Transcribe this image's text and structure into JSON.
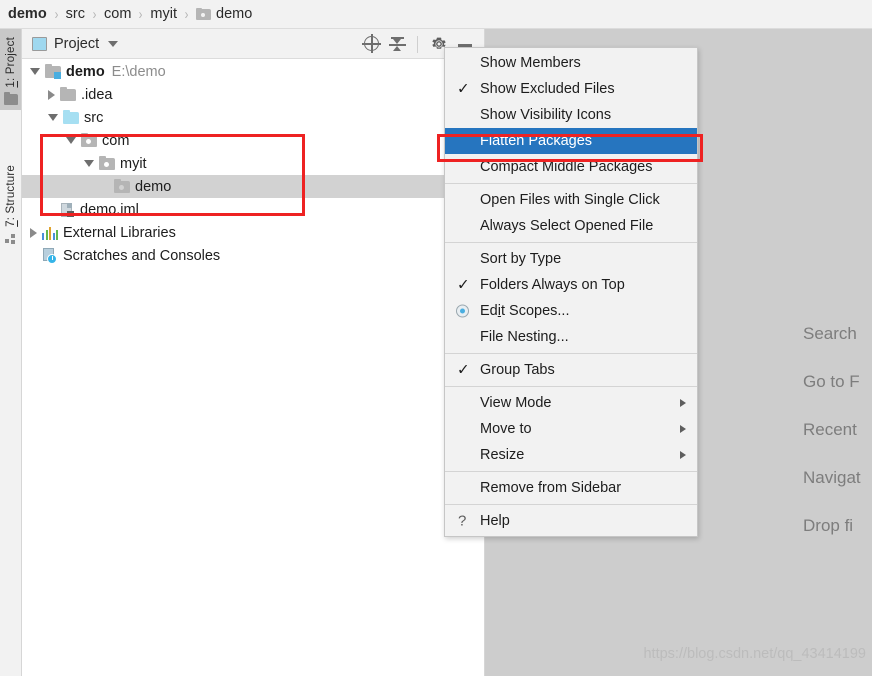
{
  "breadcrumb": {
    "items": [
      {
        "label": "demo",
        "bold": true,
        "icon": null
      },
      {
        "label": "src",
        "bold": false,
        "icon": null
      },
      {
        "label": "com",
        "bold": false,
        "icon": null
      },
      {
        "label": "myit",
        "bold": false,
        "icon": null
      },
      {
        "label": "demo",
        "bold": false,
        "icon": "folder-icon"
      }
    ],
    "separator": "›"
  },
  "tool_stripe": {
    "project_tab": {
      "index": "1",
      "label": "Project",
      "full": "1: Project",
      "icon": "folder-icon",
      "active": true
    },
    "structure_tab": {
      "index": "7",
      "label": "Structure",
      "full": "7: Structure",
      "icon": "structure-icon",
      "active": false
    }
  },
  "panel": {
    "title": "Project",
    "view_icon": "project-view-icon",
    "dropdown_icon": "chevron-down-icon",
    "tools": [
      {
        "name": "locate-in-tree-icon",
        "tooltip": "Select Opened File"
      },
      {
        "name": "collapse-all-icon",
        "tooltip": "Collapse All"
      },
      {
        "name": "gear-icon",
        "tooltip": "Settings"
      },
      {
        "name": "minimize-icon",
        "tooltip": "Hide"
      }
    ]
  },
  "tree": {
    "nodes": [
      {
        "label": "demo",
        "sub": "E:\\demo",
        "icon": "module-folder-icon",
        "twisty": "expanded",
        "indent": 0,
        "bold": true,
        "selected": false
      },
      {
        "label": ".idea",
        "sub": "",
        "icon": "folder-icon",
        "twisty": "collapsed",
        "indent": 1,
        "bold": false,
        "selected": false
      },
      {
        "label": "src",
        "sub": "",
        "icon": "source-folder-icon",
        "twisty": "expanded",
        "indent": 1,
        "bold": false,
        "selected": false
      },
      {
        "label": "com",
        "sub": "",
        "icon": "package-folder-icon",
        "twisty": "expanded",
        "indent": 2,
        "bold": false,
        "selected": false
      },
      {
        "label": "myit",
        "sub": "",
        "icon": "package-folder-icon",
        "twisty": "expanded",
        "indent": 3,
        "bold": false,
        "selected": false
      },
      {
        "label": "demo",
        "sub": "",
        "icon": "package-folder-icon",
        "twisty": "none",
        "indent": 4,
        "bold": false,
        "selected": true
      },
      {
        "label": "demo.iml",
        "sub": "",
        "icon": "iml-file-icon",
        "twisty": "none",
        "indent": 1,
        "bold": false,
        "selected": false
      },
      {
        "label": "External Libraries",
        "sub": "",
        "icon": "libraries-icon",
        "twisty": "collapsed",
        "indent": 0,
        "bold": false,
        "selected": false
      },
      {
        "label": "Scratches and Consoles",
        "sub": "",
        "icon": "scratches-icon",
        "twisty": "none",
        "indent": 0,
        "bold": false,
        "selected": false
      }
    ],
    "annotation": {
      "color": "#ee2222",
      "shape": "rectangle"
    }
  },
  "context_menu": {
    "groups": [
      {
        "items": [
          {
            "label": "Show Members",
            "marker": "none",
            "submenu": false,
            "highlighted": false
          },
          {
            "label": "Show Excluded Files",
            "marker": "check",
            "submenu": false,
            "highlighted": false
          },
          {
            "label": "Show Visibility Icons",
            "marker": "none",
            "submenu": false,
            "highlighted": false
          },
          {
            "label": "Flatten Packages",
            "marker": "none",
            "submenu": false,
            "highlighted": true
          },
          {
            "label": "Compact Middle Packages",
            "marker": "none",
            "submenu": false,
            "highlighted": false
          }
        ]
      },
      {
        "items": [
          {
            "label": "Open Files with Single Click",
            "marker": "none",
            "submenu": false,
            "highlighted": false
          },
          {
            "label": "Always Select Opened File",
            "marker": "none",
            "submenu": false,
            "highlighted": false
          }
        ]
      },
      {
        "items": [
          {
            "label": "Sort by Type",
            "marker": "none",
            "submenu": false,
            "highlighted": false
          },
          {
            "label": "Folders Always on Top",
            "marker": "check",
            "submenu": false,
            "highlighted": false
          },
          {
            "label": "Edit Scopes...",
            "marker": "radio",
            "submenu": false,
            "highlighted": false,
            "mnemonic_index": 2
          },
          {
            "label": "File Nesting...",
            "marker": "none",
            "submenu": false,
            "highlighted": false
          }
        ]
      },
      {
        "items": [
          {
            "label": "Group Tabs",
            "marker": "check",
            "submenu": false,
            "highlighted": false
          }
        ]
      },
      {
        "items": [
          {
            "label": "View Mode",
            "marker": "none",
            "submenu": true,
            "highlighted": false
          },
          {
            "label": "Move to",
            "marker": "none",
            "submenu": true,
            "highlighted": false
          },
          {
            "label": "Resize",
            "marker": "none",
            "submenu": true,
            "highlighted": false
          }
        ]
      },
      {
        "items": [
          {
            "label": "Remove from Sidebar",
            "marker": "none",
            "submenu": false,
            "highlighted": false
          }
        ]
      },
      {
        "items": [
          {
            "label": "Help",
            "marker": "help",
            "submenu": false,
            "highlighted": false
          }
        ]
      }
    ],
    "highlight_color": "#2675bf",
    "annotation": {
      "color": "#ee2222",
      "shape": "rectangle"
    }
  },
  "editor": {
    "hints": [
      "Search",
      "Go to F",
      "Recent",
      "Navigat",
      "Drop fi"
    ],
    "watermark": "https://blog.csdn.net/qq_43414199",
    "background": "#cdcdcd"
  }
}
